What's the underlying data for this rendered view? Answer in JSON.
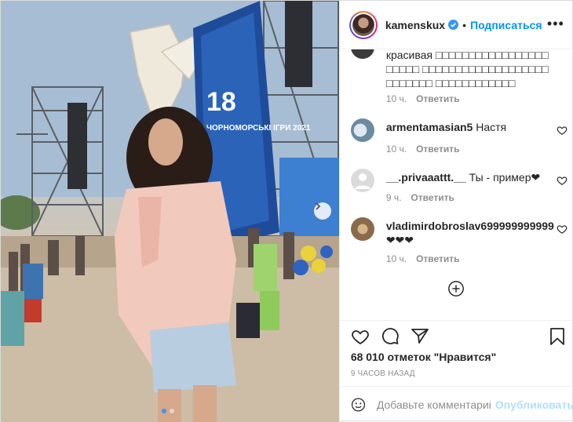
{
  "post": {
    "username": "kamenskux",
    "separator": "•",
    "follow_label": "Подписаться",
    "more_label": "•••",
    "stage_banner_number": "18",
    "stage_banner_title": "ЧОРНОМОРСЬКІ ІГРИ 2021",
    "carousel_index": 1,
    "carousel_total": 2
  },
  "comments": [
    {
      "username": "",
      "text": "красивая □□□□□□□□□□□□□□□□□□□□□□ □□□□□□□□□□□□□□□□□□□□□□□□□□ □□□□□□□□□□□□",
      "time": "10 ч.",
      "reply_label": "Ответить"
    },
    {
      "username": "armentamasian5",
      "text": "Настя",
      "time": "10 ч.",
      "reply_label": "Ответить"
    },
    {
      "username": "__.privaaattt.__",
      "text": "Ты - пример❤",
      "time": "9 ч.",
      "reply_label": "Ответить"
    },
    {
      "username": "vladimirdobroslav699999999999",
      "text": "❤❤❤",
      "time": "10 ч.",
      "reply_label": "Ответить"
    }
  ],
  "actions": {
    "likes_count": "68 010",
    "likes_label": "отметок",
    "likes_link": "\"Нравится\"",
    "time_ago": "9 ЧАСОВ НАЗАД"
  },
  "add_comment": {
    "placeholder": "Добавьте комментарий...",
    "publish_label": "Опубликовать"
  },
  "colors": {
    "accent": "#0095f6",
    "publish_disabled": "#b2dffc",
    "verified": "#3897f0",
    "muted": "#8e8e8e"
  }
}
